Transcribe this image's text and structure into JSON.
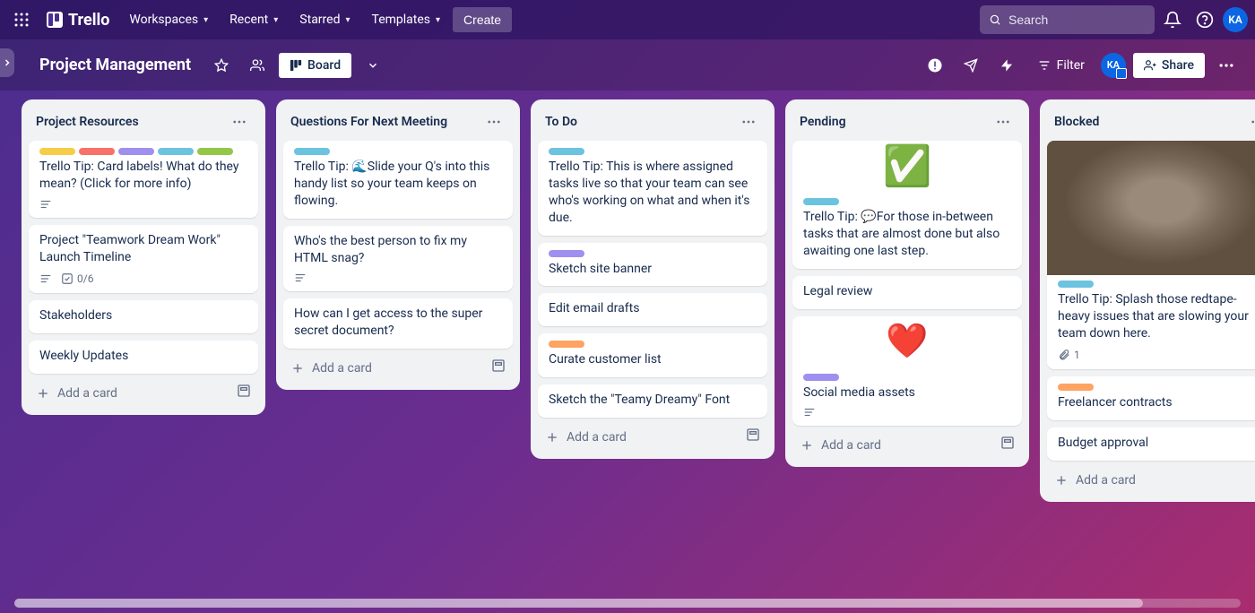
{
  "nav": {
    "logo": "Trello",
    "workspaces": "Workspaces",
    "recent": "Recent",
    "starred": "Starred",
    "templates": "Templates",
    "create": "Create"
  },
  "search": {
    "placeholder": "Search"
  },
  "user": {
    "initials": "KA"
  },
  "board": {
    "title": "Project Management",
    "view": "Board",
    "filter": "Filter",
    "share": "Share",
    "member_initials": "KA"
  },
  "lists": [
    {
      "title": "Project Resources",
      "cards": [
        {
          "labels": [
            "yellow",
            "red",
            "purple",
            "sky",
            "lime"
          ],
          "title": "Trello Tip: Card labels! What do they mean? (Click for more info)",
          "badges": {
            "desc": true
          }
        },
        {
          "title": "Project \"Teamwork Dream Work\" Launch Timeline",
          "badges": {
            "desc": true,
            "check": "0/6"
          }
        },
        {
          "title": "Stakeholders"
        },
        {
          "title": "Weekly Updates"
        }
      ],
      "add": "Add a card"
    },
    {
      "title": "Questions For Next Meeting",
      "cards": [
        {
          "labels": [
            "sky"
          ],
          "title": "Trello Tip: 🌊Slide your Q's into this handy list so your team keeps on flowing."
        },
        {
          "title": "Who's the best person to fix my HTML snag?",
          "badges": {
            "desc": true
          }
        },
        {
          "title": "How can I get access to the super secret document?"
        }
      ],
      "add": "Add a card"
    },
    {
      "title": "To Do",
      "cards": [
        {
          "labels": [
            "sky"
          ],
          "title": "Trello Tip: This is where assigned tasks live so that your team can see who's working on what and when it's due."
        },
        {
          "labels": [
            "purple"
          ],
          "title": "Sketch site banner"
        },
        {
          "title": "Edit email drafts"
        },
        {
          "labels": [
            "orange"
          ],
          "title": "Curate customer list"
        },
        {
          "title": "Sketch the \"Teamy Dreamy\" Font"
        }
      ],
      "add": "Add a card"
    },
    {
      "title": "Pending",
      "cards": [
        {
          "cover": "check",
          "labels": [
            "sky"
          ],
          "title": "Trello Tip: 💬For those in-between tasks that are almost done but also awaiting one last step."
        },
        {
          "title": "Legal review"
        },
        {
          "cover": "heart",
          "labels": [
            "purple"
          ],
          "title": "Social media assets",
          "badges": {
            "desc": true
          }
        }
      ],
      "add": "Add a card"
    },
    {
      "title": "Blocked",
      "cards": [
        {
          "cover": "cat",
          "labels": [
            "sky"
          ],
          "title": "Trello Tip: Splash those redtape-heavy issues that are slowing your team down here.",
          "badges": {
            "attach": "1"
          }
        },
        {
          "labels": [
            "orange"
          ],
          "title": "Freelancer contracts"
        },
        {
          "title": "Budget approval"
        }
      ],
      "add": "Add a card"
    }
  ]
}
